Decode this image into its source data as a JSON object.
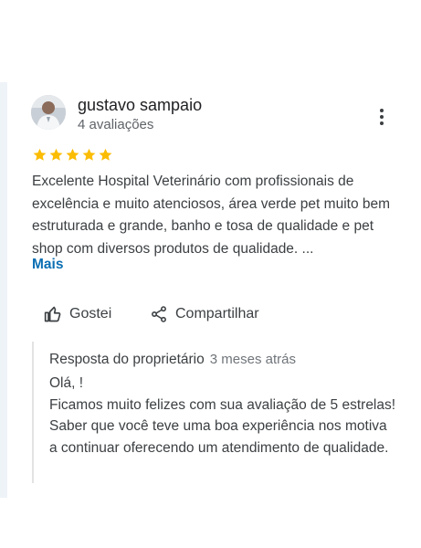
{
  "review": {
    "author": "gustavo sampaio",
    "review_count": "4 avaliações",
    "rating": 5,
    "text": "Excelente Hospital Veterinário com profissionais de excelência e muito atenciosos, área verde pet muito bem estruturada e grande, banho e tosa de qualidade e pet shop com diversos produtos de qualidade. ...",
    "more_label": "Mais",
    "star_color": "#fbbc04"
  },
  "actions": {
    "like_label": "Gostei",
    "share_label": "Compartilhar"
  },
  "owner_reply": {
    "title": "Resposta do proprietário",
    "time": "3 meses atrás",
    "text": "Olá, !\n Ficamos muito felizes com sua avaliação de 5 estrelas! Saber que você teve uma boa experiência nos motiva a continuar oferecendo um atendimento de qualidade."
  },
  "icons": {
    "more": "more-vert-icon",
    "like": "thumb-up-icon",
    "share": "share-icon",
    "star": "star-icon"
  }
}
